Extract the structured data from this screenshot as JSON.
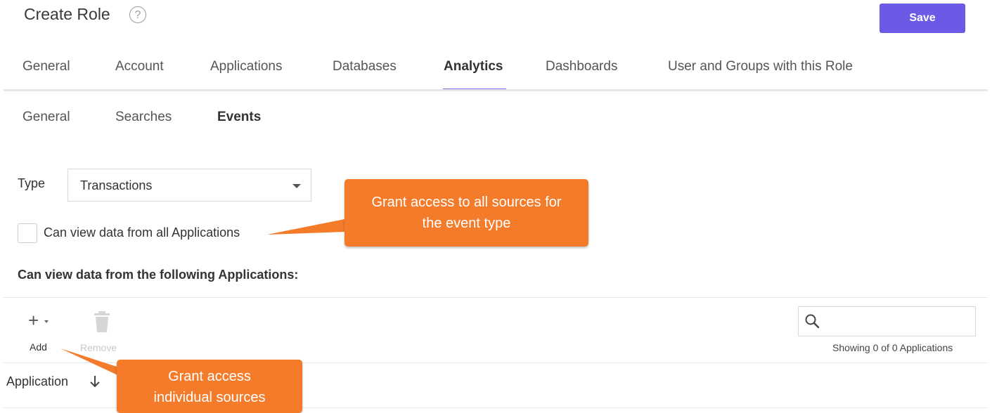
{
  "header": {
    "title": "Create Role",
    "save_label": "Save"
  },
  "tabs": [
    {
      "label": "General",
      "active": false
    },
    {
      "label": "Account",
      "active": false
    },
    {
      "label": "Applications",
      "active": false
    },
    {
      "label": "Databases",
      "active": false
    },
    {
      "label": "Analytics",
      "active": true
    },
    {
      "label": "Dashboards",
      "active": false
    },
    {
      "label": "User and Groups with this Role",
      "active": false
    }
  ],
  "subtabs": [
    {
      "label": "General",
      "active": false
    },
    {
      "label": "Searches",
      "active": false
    },
    {
      "label": "Events",
      "active": true
    }
  ],
  "form": {
    "type_label": "Type",
    "type_value": "Transactions",
    "all_apps_label": "Can view data from all Applications",
    "all_apps_checked": false,
    "section_label": "Can view data from the following Applications:"
  },
  "toolbar": {
    "add_label": "Add",
    "remove_label": "Remove",
    "search_placeholder": "",
    "showing_text": "Showing 0 of 0 Applications"
  },
  "table": {
    "column": "Application"
  },
  "callouts": {
    "all_sources": [
      "Grant access to all sources for",
      "the event type"
    ],
    "individual": [
      "Grant access",
      "individual sources"
    ]
  },
  "colors": {
    "accent": "#6a5ae6",
    "callout": "#f47b2a"
  }
}
